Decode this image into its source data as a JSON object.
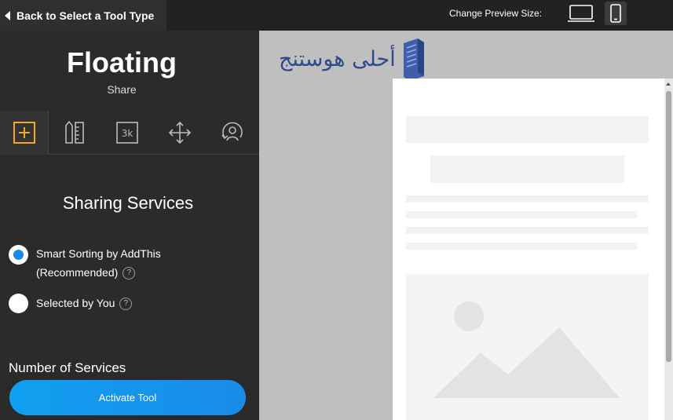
{
  "topbar": {
    "back_label": "Back to Select a Tool Type",
    "preview_label": "Change Preview Size:"
  },
  "tool": {
    "title": "Floating",
    "subtitle": "Share"
  },
  "tabs": [
    {
      "icon": "plus-box-icon",
      "active": true
    },
    {
      "icon": "pencil-ruler-icon",
      "active": false
    },
    {
      "icon": "3k-count-icon",
      "active": false
    },
    {
      "icon": "move-arrows-icon",
      "active": false
    },
    {
      "icon": "user-target-icon",
      "active": false
    }
  ],
  "sharing": {
    "title": "Sharing Services",
    "options": [
      {
        "label_line1": "Smart Sorting by AddThis",
        "label_line2": "(Recommended)",
        "selected": true
      },
      {
        "label_line1": "Selected by You",
        "selected": false
      }
    ],
    "help_glyph": "?"
  },
  "number_of_services": "Number of Services",
  "activate_label": "Activate Tool",
  "logo_text": "أحلى هوستنج",
  "colors": {
    "accent_orange": "#f5a623",
    "radio_blue": "#1a8be8",
    "button_blue": "#10a0f0",
    "panel_bg": "#2b2b2b",
    "preview_bg": "#bfbfbf"
  }
}
